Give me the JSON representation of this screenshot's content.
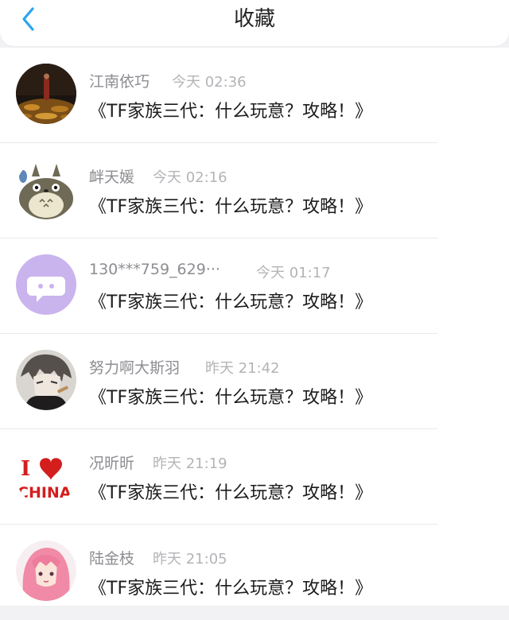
{
  "header": {
    "back_icon": "chevron-left-icon",
    "title": "收藏",
    "accent_color": "#2aa5f0"
  },
  "favorites": [
    {
      "name": "江南依巧",
      "time": "今天 02:36",
      "content": "《TF家族三代：什么玩意？攻略！》",
      "avatar": "monk-statue-avatar"
    },
    {
      "name": "衅天媛",
      "time": "今天 02:16",
      "content": "《TF家族三代：什么玩意？攻略！》",
      "avatar": "totoro-avatar"
    },
    {
      "name": "130***759_629···",
      "time": "今天 01:17",
      "content": "《TF家族三代：什么玩意？攻略！》",
      "avatar": "default-chat-avatar"
    },
    {
      "name": "努力啊大斯羽",
      "time": "昨天 21:42",
      "content": "《TF家族三代：什么玩意？攻略！》",
      "avatar": "anime-boy-avatar"
    },
    {
      "name": "况昕昕",
      "time": "昨天 21:19",
      "content": "《TF家族三代：什么玩意？攻略！》",
      "avatar": "i-love-china-avatar"
    },
    {
      "name": "陆金枝",
      "time": "昨天 21:05",
      "content": "《TF家族三代：什么玩意？攻略！》",
      "avatar": "pink-hair-girl-avatar"
    }
  ],
  "avatar_text": {
    "letter": "I",
    "word": "CHINA"
  }
}
